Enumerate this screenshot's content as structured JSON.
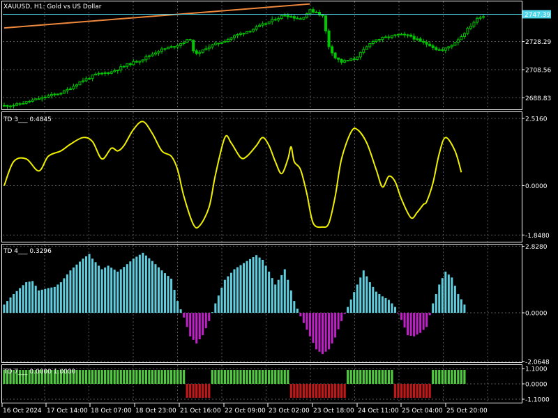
{
  "colors": {
    "background": "#000000",
    "frame": "#ffffff",
    "grid": "#5a5a5a",
    "candle": "#00c800",
    "trendline": "#f0883c",
    "price_line": "#4fd6ea",
    "price_label_bg": "#4fd6ea",
    "td3_line": "#f0f000",
    "td4_positive": "#5fcfe0",
    "td4_negative": "#c020c8",
    "td7_positive": "#50c840",
    "td7_negative": "#c01818"
  },
  "time_axis": {
    "labels": [
      "16 Oct 2024",
      "17 Oct 14:00",
      "18 Oct 07:00",
      "18 Oct 23:00",
      "21 Oct 16:00",
      "22 Oct 09:00",
      "23 Oct 02:00",
      "23 Oct 18:00",
      "24 Oct 11:00",
      "25 Oct 04:00",
      "25 Oct 20:00"
    ]
  },
  "chart_data": [
    {
      "name": "main",
      "type": "candlestick",
      "title": "XAUUSD, H1:  Gold vs US Dollar",
      "ylim": [
        2680.7,
        2756.4
      ],
      "y_ticks": [
        "2747.39",
        "2728.29",
        "2708.56",
        "2688.83"
      ],
      "current_price": "2747.39",
      "current_price_value": 2747.39,
      "anchors": [
        [
          0,
          2683
        ],
        [
          5,
          2684
        ],
        [
          10,
          2687
        ],
        [
          15,
          2690
        ],
        [
          20,
          2693
        ],
        [
          25,
          2700
        ],
        [
          30,
          2705
        ],
        [
          35,
          2707
        ],
        [
          40,
          2712
        ],
        [
          45,
          2716
        ],
        [
          50,
          2722
        ],
        [
          55,
          2725
        ],
        [
          60,
          2730
        ],
        [
          61,
          2721
        ],
        [
          63,
          2720
        ],
        [
          65,
          2724
        ],
        [
          70,
          2728
        ],
        [
          75,
          2733
        ],
        [
          80,
          2737
        ],
        [
          85,
          2742
        ],
        [
          90,
          2747
        ],
        [
          95,
          2744
        ],
        [
          98,
          2750
        ],
        [
          100,
          2749
        ],
        [
          102,
          2746
        ],
        [
          104,
          2725
        ],
        [
          106,
          2717
        ],
        [
          108,
          2714
        ],
        [
          112,
          2716
        ],
        [
          115,
          2722
        ],
        [
          118,
          2729
        ],
        [
          122,
          2731
        ],
        [
          126,
          2733
        ],
        [
          130,
          2732
        ],
        [
          133,
          2728
        ],
        [
          136,
          2726
        ],
        [
          138,
          2723
        ],
        [
          140,
          2722
        ],
        [
          143,
          2726
        ],
        [
          146,
          2732
        ],
        [
          150,
          2742
        ],
        [
          152,
          2746
        ]
      ],
      "trendline": [
        [
          0,
          2737.8
        ],
        [
          97,
          2754.6
        ]
      ]
    },
    {
      "name": "td3",
      "type": "line",
      "title": "TD 3___  0.4845",
      "ylim": [
        -2.1,
        2.75
      ],
      "y_ticks": [
        "2.5160",
        "0.0000",
        "-1.8480"
      ],
      "y_tick_values": [
        2.516,
        0,
        -1.848
      ],
      "zero_label": "0.0000",
      "points": [
        [
          0,
          0
        ],
        [
          3,
          0.9
        ],
        [
          7,
          1.0
        ],
        [
          11,
          0.55
        ],
        [
          14,
          1.1
        ],
        [
          18,
          1.3
        ],
        [
          21,
          1.55
        ],
        [
          25,
          1.8
        ],
        [
          28,
          1.65
        ],
        [
          31,
          1.0
        ],
        [
          34,
          1.4
        ],
        [
          36,
          1.3
        ],
        [
          38,
          1.5
        ],
        [
          41,
          2.1
        ],
        [
          44,
          2.4
        ],
        [
          47,
          1.95
        ],
        [
          50,
          1.3
        ],
        [
          53,
          1.1
        ],
        [
          55,
          0.6
        ],
        [
          57,
          -0.4
        ],
        [
          60,
          -1.45
        ],
        [
          62,
          -1.5
        ],
        [
          65,
          -0.8
        ],
        [
          67,
          0.4
        ],
        [
          70,
          1.8
        ],
        [
          72,
          1.6
        ],
        [
          75,
          1.05
        ],
        [
          77,
          1.1
        ],
        [
          80,
          1.5
        ],
        [
          82,
          1.8
        ],
        [
          84,
          1.5
        ],
        [
          86,
          0.9
        ],
        [
          88,
          0.45
        ],
        [
          90,
          1.0
        ],
        [
          91,
          1.45
        ],
        [
          92,
          0.9
        ],
        [
          94,
          0.6
        ],
        [
          96,
          -0.3
        ],
        [
          98,
          -1.4
        ],
        [
          101,
          -1.55
        ],
        [
          103,
          -1.4
        ],
        [
          105,
          -0.4
        ],
        [
          107,
          1.0
        ],
        [
          110,
          2.0
        ],
        [
          112,
          2.1
        ],
        [
          115,
          1.6
        ],
        [
          118,
          0.6
        ],
        [
          120,
          -0.05
        ],
        [
          122,
          0.35
        ],
        [
          124,
          0.15
        ],
        [
          126,
          -0.5
        ],
        [
          129,
          -1.2
        ],
        [
          131,
          -1.0
        ],
        [
          133,
          -0.7
        ],
        [
          134,
          -0.6
        ],
        [
          136,
          0.1
        ],
        [
          138,
          1.2
        ],
        [
          140,
          1.8
        ],
        [
          143,
          1.3
        ],
        [
          145,
          0.5
        ]
      ]
    },
    {
      "name": "td4",
      "type": "bar",
      "title": "TD 4___  0.3296",
      "ylim": [
        -2.1,
        2.9
      ],
      "y_ticks": [
        "2.8280",
        "0.0000",
        "-2.0648"
      ],
      "y_tick_values": [
        2.828,
        0,
        -2.0648
      ],
      "anchors": [
        [
          0,
          0.35
        ],
        [
          3,
          0.8
        ],
        [
          7,
          1.3
        ],
        [
          9,
          1.35
        ],
        [
          11,
          0.95
        ],
        [
          14,
          1.05
        ],
        [
          16,
          1.1
        ],
        [
          18,
          1.3
        ],
        [
          21,
          1.8
        ],
        [
          25,
          2.3
        ],
        [
          27,
          2.5
        ],
        [
          28,
          2.3
        ],
        [
          31,
          1.85
        ],
        [
          33,
          2.0
        ],
        [
          36,
          1.75
        ],
        [
          38,
          1.95
        ],
        [
          41,
          2.3
        ],
        [
          44,
          2.55
        ],
        [
          47,
          2.2
        ],
        [
          50,
          1.8
        ],
        [
          53,
          1.45
        ],
        [
          55,
          0.5
        ],
        [
          57,
          -0.2
        ],
        [
          59,
          -1.0
        ],
        [
          61,
          -1.3
        ],
        [
          63,
          -0.95
        ],
        [
          65,
          -0.35
        ],
        [
          67,
          0.4
        ],
        [
          70,
          1.4
        ],
        [
          73,
          1.85
        ],
        [
          77,
          2.2
        ],
        [
          80,
          2.45
        ],
        [
          82,
          2.25
        ],
        [
          84,
          1.75
        ],
        [
          86,
          1.2
        ],
        [
          88,
          1.6
        ],
        [
          89,
          1.85
        ],
        [
          90,
          1.4
        ],
        [
          92,
          0.5
        ],
        [
          94,
          -0.15
        ],
        [
          97,
          -1.0
        ],
        [
          99,
          -1.55
        ],
        [
          101,
          -1.75
        ],
        [
          103,
          -1.55
        ],
        [
          105,
          -1.05
        ],
        [
          107,
          -0.35
        ],
        [
          109,
          0.25
        ],
        [
          112,
          1.2
        ],
        [
          114,
          1.8
        ],
        [
          116,
          1.3
        ],
        [
          118,
          0.9
        ],
        [
          120,
          0.7
        ],
        [
          122,
          0.55
        ],
        [
          124,
          0.25
        ],
        [
          126,
          -0.3
        ],
        [
          128,
          -0.95
        ],
        [
          130,
          -1.0
        ],
        [
          132,
          -0.85
        ],
        [
          134,
          -0.6
        ],
        [
          136,
          0.4
        ],
        [
          138,
          1.2
        ],
        [
          140,
          1.75
        ],
        [
          142,
          1.5
        ],
        [
          144,
          0.8
        ],
        [
          146,
          0.35
        ]
      ]
    },
    {
      "name": "td7",
      "type": "bar",
      "title": "TD 7___  0.0000  1.0000",
      "ylim": [
        -1.35,
        1.35
      ],
      "y_ticks": [
        "1.1000",
        "0.0000",
        "-1.1000"
      ],
      "y_tick_values": [
        1.1,
        0,
        -1.1
      ],
      "segments": [
        [
          0,
          57,
          1
        ],
        [
          58,
          65,
          -1
        ],
        [
          66,
          90,
          1
        ],
        [
          91,
          108,
          -1
        ],
        [
          109,
          123,
          1
        ],
        [
          124,
          135,
          -1
        ],
        [
          136,
          146,
          1
        ]
      ]
    }
  ]
}
